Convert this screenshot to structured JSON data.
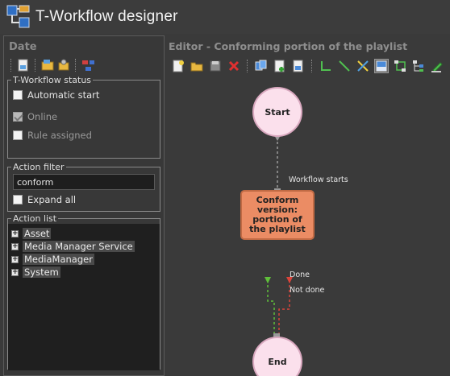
{
  "app": {
    "title": "T-Workflow designer",
    "logo_icon": "workflow-logo-icon"
  },
  "left_panel": {
    "header": "Date",
    "toolbar": [
      "new-doc-icon",
      "open-folder-icon",
      "settings-stack-icon",
      "hierarchy-icon"
    ],
    "status": {
      "legend": "T-Workflow status",
      "automatic_start": {
        "label": "Automatic start",
        "checked": false
      },
      "online": {
        "label": "Online",
        "checked": true,
        "disabled": true
      },
      "rule_assigned": {
        "label": "Rule assigned",
        "checked": false,
        "disabled": true
      }
    },
    "action_filter": {
      "legend": "Action filter",
      "value": "conform",
      "expand_all": {
        "label": "Expand all",
        "checked": false
      }
    },
    "action_list": {
      "legend": "Action list",
      "items": [
        {
          "label": "Asset"
        },
        {
          "label": "Media Manager Service"
        },
        {
          "label": "MediaManager"
        },
        {
          "label": "System"
        }
      ]
    }
  },
  "editor": {
    "header": "Editor - Conforming portion of the playlist",
    "toolbar": [
      "new-icon",
      "open-icon",
      "save-icon",
      "delete-icon",
      "copy-icon",
      "add-node-icon",
      "export-icon",
      "connector-elbow-icon",
      "connector-line-icon",
      "cross-icon",
      "layout-icon",
      "route-icon",
      "tree-icon",
      "pen-icon"
    ],
    "nodes": {
      "start": "Start",
      "action": "Conform version: portion of the playlist",
      "end": "End"
    },
    "edges": {
      "workflow_starts": "Workflow starts",
      "done": "Done",
      "not_done": "Not done"
    },
    "colors": {
      "circle_fill": "#fbe0ec",
      "action_fill": "#eb8c64",
      "done_edge": "#5fbf3a",
      "not_done_edge": "#d9443a"
    }
  }
}
